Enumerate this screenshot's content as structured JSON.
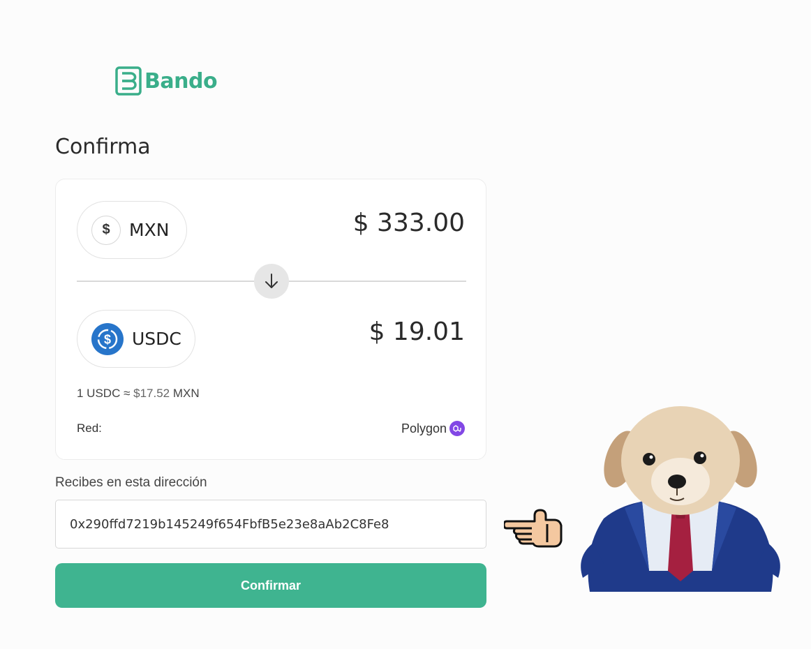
{
  "brand": {
    "name": "Bando",
    "color": "#3aae8a"
  },
  "page": {
    "title": "Confirma"
  },
  "from": {
    "icon": "dollar-icon",
    "icon_glyph": "$",
    "currency": "MXN",
    "amount": "$ 333.00"
  },
  "swap": {
    "icon": "arrow-down-icon"
  },
  "to": {
    "icon": "usdc-icon",
    "currency": "USDC",
    "amount": "$ 19.01"
  },
  "rate": {
    "prefix": "1 USDC ≈",
    "value": "$17.52",
    "suffix": "MXN"
  },
  "network": {
    "label": "Red:",
    "value": "Polygon",
    "icon": "polygon-icon"
  },
  "address": {
    "label": "Recibes en esta dirección",
    "value": "0x290ffd7219b145249f654FbfB5e23e8aAb2C8Fe8"
  },
  "actions": {
    "confirm_label": "Confirmar"
  },
  "colors": {
    "accent": "#3fb490",
    "usdc": "#2775ca",
    "polygon": "#8247e5"
  },
  "decorations": {
    "pointer": "pointing-hand-icon",
    "mascot": "dog-in-suit-image"
  }
}
